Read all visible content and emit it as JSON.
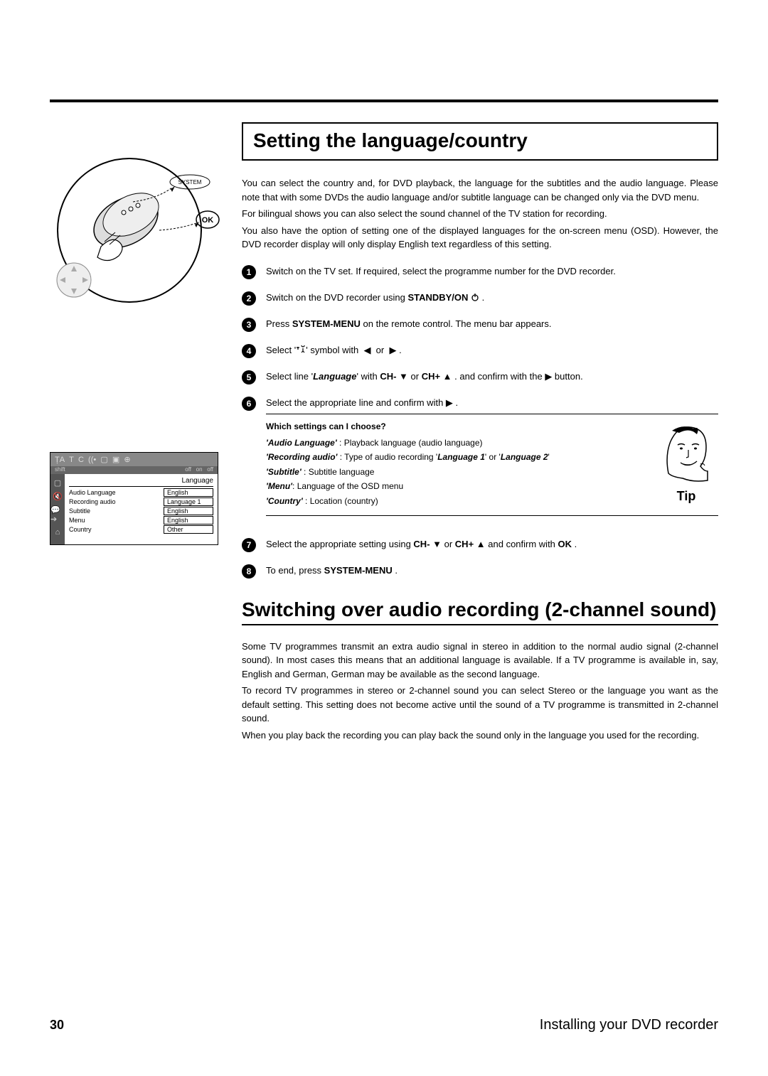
{
  "header_title": "Setting the language/country",
  "intro": {
    "p1": "You can select the country and, for DVD playback, the language for the subtitles and the audio language. Please note that with some DVDs the audio language and/or subtitle language can be changed only via the DVD menu.",
    "p2": "For bilingual shows you can also select the sound channel of the TV station for recording.",
    "p3": "You also have the option of setting one of the displayed languages for the on-screen menu (OSD). However, the DVD recorder display will only display English text regardless of this setting."
  },
  "steps": {
    "s1": "Switch on the TV set. If required, select the programme number for the DVD recorder.",
    "s2_pre": "Switch on the DVD recorder using ",
    "s2_bold": "STANDBY/ON",
    "s2_post": " .",
    "s3_pre": "Press ",
    "s3_bold": "SYSTEM-MENU",
    "s3_post": " on the remote control. The menu bar appears.",
    "s4": "Select '     ' symbol with  ◀  or  ▶ .",
    "s5_pre": "Select line '",
    "s5_bi": "Language",
    "s5_mid1": "' with ",
    "s5_b1": "CH-",
    "s5_mid2": " ▼  or ",
    "s5_b2": "CH+",
    "s5_mid3": " ▲ . and confirm with the  ▶  button.",
    "s6": "Select the appropriate line and confirm with  ▶ .",
    "s7_pre": "Select the appropriate setting using ",
    "s7_b1": "CH-",
    "s7_mid1": " ▼  or ",
    "s7_b2": "CH+",
    "s7_mid2": " ▲  and confirm with ",
    "s7_b3": "OK",
    "s7_post": " .",
    "s8_pre": "To end, press ",
    "s8_bold": "SYSTEM-MENU",
    "s8_post": " ."
  },
  "tip": {
    "question": "Which settings can I choose?",
    "audio_lang_label": "'Audio Language'",
    "audio_lang_desc": " : Playback language (audio language)",
    "rec_audio_label": "'Recording audio'",
    "rec_audio_desc_pre": " : Type of audio recording '",
    "rec_audio_l1": "Language 1",
    "rec_audio_mid": "' or '",
    "rec_audio_l2": "Language 2",
    "rec_audio_post": "'",
    "subtitle_label": "'Subtitle'",
    "subtitle_desc": " : Subtitle language",
    "menu_label": "'Menu'",
    "menu_desc": ": Language of the OSD menu",
    "country_label": "'Country'",
    "country_desc": " : Location (country)",
    "tip_word": "Tip"
  },
  "section2_title": "Switching over audio recording (2-channel sound)",
  "section2": {
    "p1": "Some TV programmes transmit an extra audio signal in stereo in addition to the normal audio signal (2-channel sound). In most cases this means that an additional language is available. If a TV programme is available in, say, English and German, German may be available as the second language.",
    "p2": "To record TV programmes in stereo or 2-channel sound you can select Stereo or the language you want as the default setting. This setting does not become active until the sound of a TV programme is transmitted in 2-channel sound.",
    "p3": "When you play back the recording you can play back the sound only in the language you used for the recording."
  },
  "menu": {
    "header": "Language",
    "rows": [
      {
        "label": "Audio Language",
        "value": "English"
      },
      {
        "label": "Recording audio",
        "value": "Language 1"
      },
      {
        "label": "Subtitle",
        "value": "English"
      },
      {
        "label": "Menu",
        "value": "English"
      },
      {
        "label": "Country",
        "value": "Other"
      }
    ],
    "top_icons": "TA   T   C",
    "top_right": "off    on    off"
  },
  "remote": {
    "system": "SYSTEM",
    "ok": "OK"
  },
  "footer": {
    "page": "30",
    "title": "Installing your DVD recorder"
  }
}
